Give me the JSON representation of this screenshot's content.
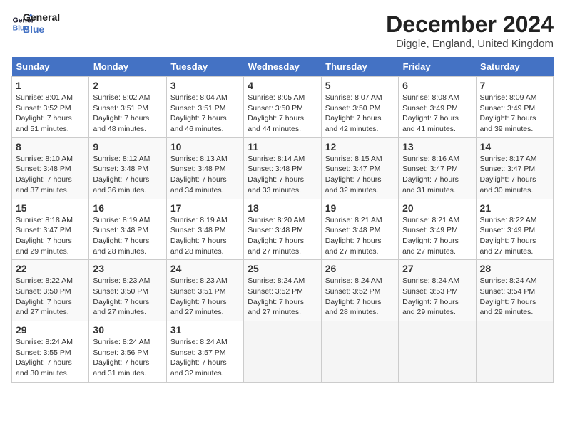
{
  "header": {
    "logo_line1": "General",
    "logo_line2": "Blue",
    "title": "December 2024",
    "location": "Diggle, England, United Kingdom"
  },
  "days_of_week": [
    "Sunday",
    "Monday",
    "Tuesday",
    "Wednesday",
    "Thursday",
    "Friday",
    "Saturday"
  ],
  "weeks": [
    [
      {
        "day": "1",
        "sunrise": "8:01 AM",
        "sunset": "3:52 PM",
        "daylight": "7 hours and 51 minutes."
      },
      {
        "day": "2",
        "sunrise": "8:02 AM",
        "sunset": "3:51 PM",
        "daylight": "7 hours and 48 minutes."
      },
      {
        "day": "3",
        "sunrise": "8:04 AM",
        "sunset": "3:51 PM",
        "daylight": "7 hours and 46 minutes."
      },
      {
        "day": "4",
        "sunrise": "8:05 AM",
        "sunset": "3:50 PM",
        "daylight": "7 hours and 44 minutes."
      },
      {
        "day": "5",
        "sunrise": "8:07 AM",
        "sunset": "3:50 PM",
        "daylight": "7 hours and 42 minutes."
      },
      {
        "day": "6",
        "sunrise": "8:08 AM",
        "sunset": "3:49 PM",
        "daylight": "7 hours and 41 minutes."
      },
      {
        "day": "7",
        "sunrise": "8:09 AM",
        "sunset": "3:49 PM",
        "daylight": "7 hours and 39 minutes."
      }
    ],
    [
      {
        "day": "8",
        "sunrise": "8:10 AM",
        "sunset": "3:48 PM",
        "daylight": "7 hours and 37 minutes."
      },
      {
        "day": "9",
        "sunrise": "8:12 AM",
        "sunset": "3:48 PM",
        "daylight": "7 hours and 36 minutes."
      },
      {
        "day": "10",
        "sunrise": "8:13 AM",
        "sunset": "3:48 PM",
        "daylight": "7 hours and 34 minutes."
      },
      {
        "day": "11",
        "sunrise": "8:14 AM",
        "sunset": "3:48 PM",
        "daylight": "7 hours and 33 minutes."
      },
      {
        "day": "12",
        "sunrise": "8:15 AM",
        "sunset": "3:47 PM",
        "daylight": "7 hours and 32 minutes."
      },
      {
        "day": "13",
        "sunrise": "8:16 AM",
        "sunset": "3:47 PM",
        "daylight": "7 hours and 31 minutes."
      },
      {
        "day": "14",
        "sunrise": "8:17 AM",
        "sunset": "3:47 PM",
        "daylight": "7 hours and 30 minutes."
      }
    ],
    [
      {
        "day": "15",
        "sunrise": "8:18 AM",
        "sunset": "3:47 PM",
        "daylight": "7 hours and 29 minutes."
      },
      {
        "day": "16",
        "sunrise": "8:19 AM",
        "sunset": "3:48 PM",
        "daylight": "7 hours and 28 minutes."
      },
      {
        "day": "17",
        "sunrise": "8:19 AM",
        "sunset": "3:48 PM",
        "daylight": "7 hours and 28 minutes."
      },
      {
        "day": "18",
        "sunrise": "8:20 AM",
        "sunset": "3:48 PM",
        "daylight": "7 hours and 27 minutes."
      },
      {
        "day": "19",
        "sunrise": "8:21 AM",
        "sunset": "3:48 PM",
        "daylight": "7 hours and 27 minutes."
      },
      {
        "day": "20",
        "sunrise": "8:21 AM",
        "sunset": "3:49 PM",
        "daylight": "7 hours and 27 minutes."
      },
      {
        "day": "21",
        "sunrise": "8:22 AM",
        "sunset": "3:49 PM",
        "daylight": "7 hours and 27 minutes."
      }
    ],
    [
      {
        "day": "22",
        "sunrise": "8:22 AM",
        "sunset": "3:50 PM",
        "daylight": "7 hours and 27 minutes."
      },
      {
        "day": "23",
        "sunrise": "8:23 AM",
        "sunset": "3:50 PM",
        "daylight": "7 hours and 27 minutes."
      },
      {
        "day": "24",
        "sunrise": "8:23 AM",
        "sunset": "3:51 PM",
        "daylight": "7 hours and 27 minutes."
      },
      {
        "day": "25",
        "sunrise": "8:24 AM",
        "sunset": "3:52 PM",
        "daylight": "7 hours and 27 minutes."
      },
      {
        "day": "26",
        "sunrise": "8:24 AM",
        "sunset": "3:52 PM",
        "daylight": "7 hours and 28 minutes."
      },
      {
        "day": "27",
        "sunrise": "8:24 AM",
        "sunset": "3:53 PM",
        "daylight": "7 hours and 29 minutes."
      },
      {
        "day": "28",
        "sunrise": "8:24 AM",
        "sunset": "3:54 PM",
        "daylight": "7 hours and 29 minutes."
      }
    ],
    [
      {
        "day": "29",
        "sunrise": "8:24 AM",
        "sunset": "3:55 PM",
        "daylight": "7 hours and 30 minutes."
      },
      {
        "day": "30",
        "sunrise": "8:24 AM",
        "sunset": "3:56 PM",
        "daylight": "7 hours and 31 minutes."
      },
      {
        "day": "31",
        "sunrise": "8:24 AM",
        "sunset": "3:57 PM",
        "daylight": "7 hours and 32 minutes."
      },
      null,
      null,
      null,
      null
    ]
  ]
}
